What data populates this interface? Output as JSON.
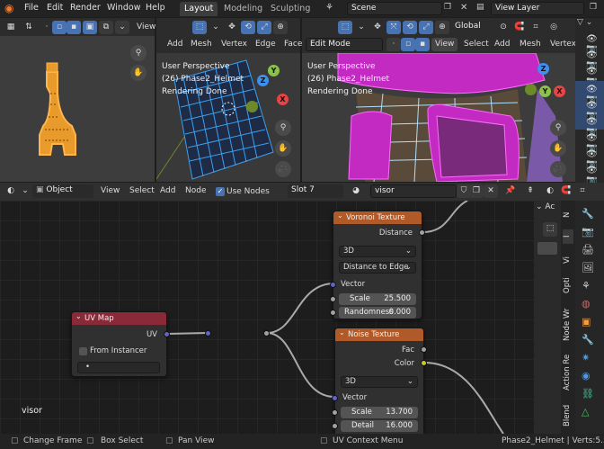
{
  "menubar": {
    "items": [
      "File",
      "Edit",
      "Render",
      "Window",
      "Help"
    ],
    "workspaces": [
      "Layout",
      "Modeling",
      "Sculpting"
    ],
    "scene_label": "Scene",
    "view_layer_label": "View Layer"
  },
  "viewport_left": {
    "header_buttons": [
      "View"
    ]
  },
  "viewport_mid": {
    "header_buttons": [
      "Add",
      "Mesh",
      "Vertex",
      "Edge",
      "Face"
    ],
    "overlay": [
      "User Perspective",
      "(26) Phase2_Helmet",
      "Rendering Done"
    ]
  },
  "viewport_right": {
    "mode": "Edit Mode",
    "transform": "Global",
    "header_buttons": [
      "View",
      "Select",
      "Add",
      "Mesh",
      "Vertex"
    ],
    "overlay": [
      "User Perspective",
      "(26) Phase2_Helmet",
      "Rendering Done"
    ]
  },
  "gizmo": {
    "x": "X",
    "y": "Y",
    "z": "Z"
  },
  "node_header": {
    "object_label": "Object",
    "menus": [
      "View",
      "Select",
      "Add",
      "Node"
    ],
    "use_nodes_label": "Use Nodes",
    "slot": "Slot 7",
    "material": "visor"
  },
  "nodes": {
    "uv_map": {
      "title": "UV Map",
      "output": "UV",
      "from_instancer": "From Instancer",
      "uv_field": "•"
    },
    "voronoi": {
      "title": "Voronoi Texture",
      "output": "Distance",
      "dimension": "3D",
      "feature": "Distance to Edge",
      "input_vector": "Vector",
      "scale_label": "Scale",
      "scale_value": "25.500",
      "randomness_label": "Randomness",
      "randomness_value": "0.000"
    },
    "noise": {
      "title": "Noise Texture",
      "output_fac": "Fac",
      "output_color": "Color",
      "dimension": "3D",
      "input_vector": "Vector",
      "scale_label": "Scale",
      "scale_value": "13.700",
      "detail_label": "Detail",
      "detail_value": "16.000"
    }
  },
  "node_editor": {
    "material_label": "visor"
  },
  "sidebar_tabs": [
    "N",
    "Vi",
    "Opti",
    "Node Wr",
    "Action Re",
    "Blend"
  ],
  "sidebar_top": "Ac",
  "statusbar": {
    "change_frame": "Change Frame",
    "box_select": "Box Select",
    "pan_view": "Pan View",
    "uv_context": "UV Context Menu",
    "stats": "Phase2_Helmet | Verts:5.5..."
  },
  "colors": {
    "voronoi_header": "#b05a2a",
    "noise_header": "#b05a2a",
    "uv_header": "#8a2a38",
    "socket_vector": "#6363c7",
    "socket_float": "#a1a1a1",
    "socket_color": "#c7c729",
    "edit_magenta": "#c22ac2",
    "uv_orange": "#e89a2a"
  }
}
